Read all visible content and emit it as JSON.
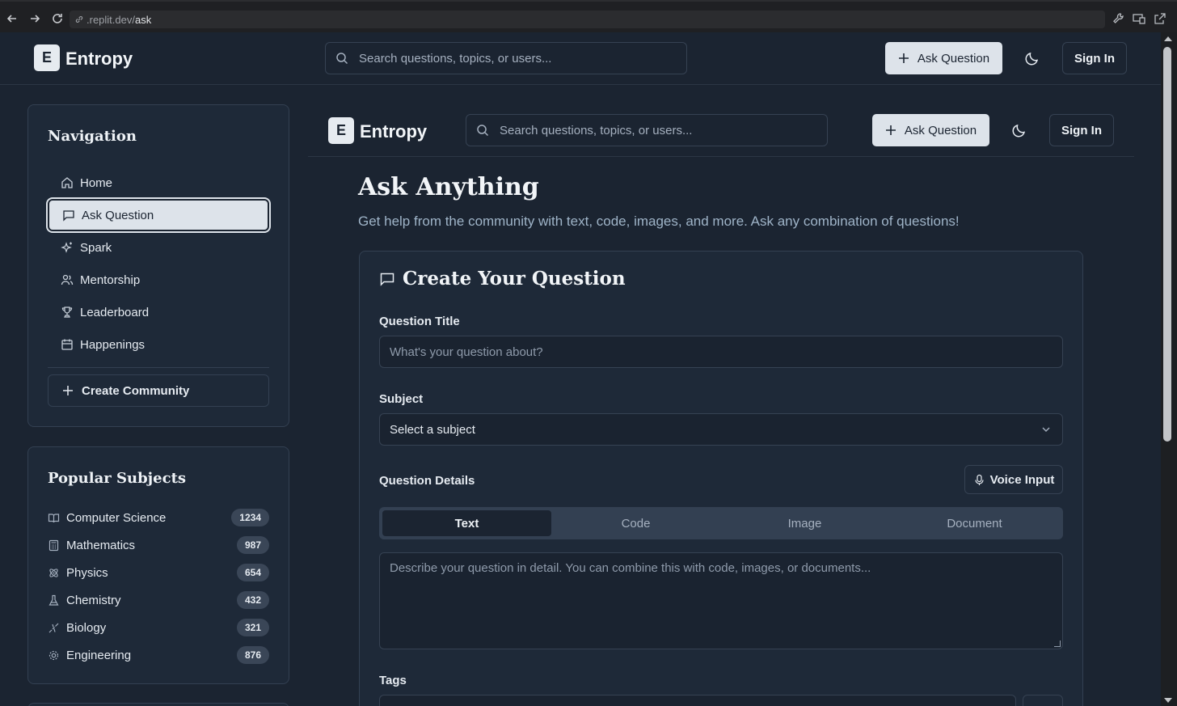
{
  "browser": {
    "url_host": ".replit.dev/",
    "url_path": "ask"
  },
  "header": {
    "logo_letter": "E",
    "logo_text": "Entropy",
    "search_placeholder": "Search questions, topics, or users...",
    "ask_button": "Ask Question",
    "sign_in": "Sign In"
  },
  "inner_header": {
    "logo_letter": "E",
    "logo_text": "Entropy",
    "search_placeholder": "Search questions, topics, or users...",
    "ask_button": "Ask Question",
    "sign_in": "Sign In"
  },
  "sidebar": {
    "nav_title": "Navigation",
    "items": [
      {
        "label": "Home",
        "icon": "home-icon"
      },
      {
        "label": "Ask Question",
        "icon": "message-square-icon",
        "active": true
      },
      {
        "label": "Spark",
        "icon": "sparkles-icon"
      },
      {
        "label": "Mentorship",
        "icon": "users-icon"
      },
      {
        "label": "Leaderboard",
        "icon": "trophy-icon"
      },
      {
        "label": "Happenings",
        "icon": "calendar-icon"
      }
    ],
    "create_community": "Create Community",
    "subjects_title": "Popular Subjects",
    "subjects": [
      {
        "label": "Computer Science",
        "count": "1234",
        "icon": "book-open-icon"
      },
      {
        "label": "Mathematics",
        "count": "987",
        "icon": "calculator-icon"
      },
      {
        "label": "Physics",
        "count": "654",
        "icon": "atom-icon"
      },
      {
        "label": "Chemistry",
        "count": "432",
        "icon": "flask-icon"
      },
      {
        "label": "Biology",
        "count": "321",
        "icon": "dna-icon"
      },
      {
        "label": "Engineering",
        "count": "876",
        "icon": "cog-icon"
      }
    ]
  },
  "main": {
    "title": "Ask Anything",
    "subtitle": "Get help from the community with text, code, images, and more. Ask any combination of questions!",
    "form": {
      "title": "Create Your Question",
      "question_title_label": "Question Title",
      "question_title_placeholder": "What's your question about?",
      "subject_label": "Subject",
      "subject_value": "Select a subject",
      "details_label": "Question Details",
      "voice_input": "Voice Input",
      "tabs": [
        "Text",
        "Code",
        "Image",
        "Document"
      ],
      "active_tab": "Text",
      "details_placeholder": "Describe your question in detail. You can combine this with code, images, or documents...",
      "tags_label": "Tags"
    }
  },
  "colors": {
    "background": "#1b2431",
    "card": "#1e2938",
    "primary_button": "#dde3ea",
    "accent_text": "#9fb4c8"
  }
}
